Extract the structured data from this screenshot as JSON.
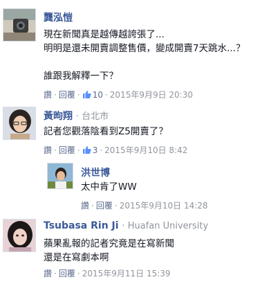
{
  "comments": [
    {
      "author": "龔泓愷",
      "body": "現在新聞真是越傳越誇張了...\n明明是還未開賣調整售價，變成開賣7天跳水...？\n\n誰跟我解釋一下？",
      "reply_label": "讚",
      "reply2_label": "回覆",
      "likes": "10",
      "timestamp": "2015年9月9日 20:30"
    },
    {
      "author": "黃昫翔",
      "location": "台北市",
      "body": "記者您觀落陰看到Z5開賣了？",
      "reply_label": "讚",
      "reply2_label": "回覆",
      "likes": "3",
      "timestamp": "2015年9月10日 8:42"
    },
    {
      "author": "洪世博",
      "body": "太中肯了WW",
      "reply_label": "讚",
      "reply2_label": "回覆",
      "timestamp": "2015年9月10日 14:28"
    },
    {
      "author": "Tsubasa Rin Ji",
      "affiliation": "Huafan University",
      "body": "蘋果亂報的記者究竟是在寫新聞\n還是在寫劇本啊",
      "reply_label": "讚",
      "reply2_label": "回覆",
      "timestamp": "2015年9月11日 15:39"
    }
  ],
  "colors": {
    "name": "#3b5998",
    "link": "#5b6b8c",
    "muted": "#90949c",
    "like_icon": "#5890ff"
  },
  "icons": [
    "thumbs-up-icon"
  ]
}
